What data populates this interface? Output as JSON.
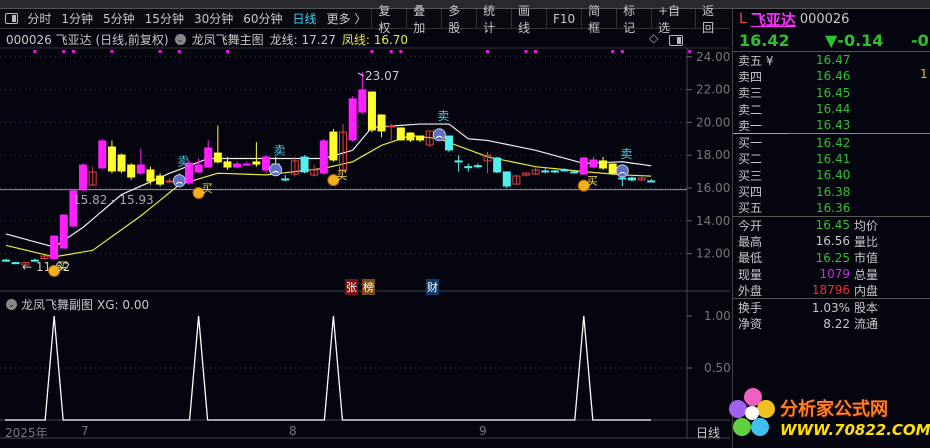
{
  "toolbar": {
    "periods": [
      "分时",
      "1分钟",
      "5分钟",
      "15分钟",
      "30分钟",
      "60分钟",
      "日线",
      "更多 〉"
    ],
    "active": "日线",
    "buttons": [
      "复权",
      "叠加",
      "多股",
      "统计",
      "画线",
      "F10",
      "简框",
      "标记",
      "+自选",
      "返回"
    ]
  },
  "info": {
    "code_name": "000026 飞亚达 (日线,前复权)",
    "indicator": "龙凤飞舞主图",
    "long_label": "龙线: 17.27",
    "phoenix_label": "凤线: 16.70"
  },
  "chart_data": {
    "type": "candlestick",
    "ylim": [
      11,
      24.5
    ],
    "yticks": [
      "24.00",
      "22.00",
      "20.00",
      "18.00",
      "16.00",
      "14.00",
      "12.00"
    ],
    "ytick_values": [
      24,
      22,
      20,
      18,
      16,
      14,
      12
    ],
    "candles": [
      [
        11.6,
        11.6,
        11.7,
        11.5,
        "c"
      ],
      [
        11.45,
        11.4,
        11.5,
        11.35,
        "c"
      ],
      [
        11.3,
        11.45,
        11.5,
        11.3,
        "r"
      ],
      [
        11.6,
        11.6,
        11.7,
        11.5,
        "c"
      ],
      [
        11.7,
        11.85,
        11.9,
        11.65,
        "r"
      ],
      [
        11.7,
        13.07,
        13.1,
        11.6,
        "m"
      ],
      [
        12.34,
        14.35,
        14.4,
        12.3,
        "m"
      ],
      [
        13.68,
        15.82,
        15.9,
        13.6,
        "m"
      ],
      [
        15.88,
        17.4,
        17.5,
        15.8,
        "m"
      ],
      [
        16.18,
        16.98,
        17.3,
        16.1,
        "r"
      ],
      [
        17.22,
        18.87,
        19.0,
        17.2,
        "m"
      ],
      [
        18.5,
        17.04,
        18.9,
        16.9,
        "y"
      ],
      [
        18.01,
        17.04,
        18.1,
        16.9,
        "y"
      ],
      [
        17.4,
        16.67,
        17.5,
        16.5,
        "y"
      ],
      [
        16.91,
        17.4,
        18.4,
        16.8,
        "m"
      ],
      [
        17.1,
        16.43,
        17.3,
        16.2,
        "y"
      ],
      [
        16.73,
        16.24,
        16.9,
        16.1,
        "y"
      ],
      [
        16.43,
        16.43,
        16.6,
        16.3,
        "r"
      ],
      [
        16.61,
        16.61,
        16.9,
        16.5,
        "c"
      ],
      [
        16.3,
        17.52,
        17.7,
        16.2,
        "m"
      ],
      [
        16.98,
        17.4,
        17.8,
        16.9,
        "m"
      ],
      [
        17.28,
        18.44,
        18.9,
        17.2,
        "m"
      ],
      [
        18.13,
        17.59,
        19.8,
        17.5,
        "y"
      ],
      [
        17.59,
        17.28,
        17.9,
        17.1,
        "y"
      ],
      [
        17.28,
        17.46,
        17.6,
        17.2,
        "m"
      ],
      [
        17.46,
        17.46,
        17.6,
        17.35,
        "m"
      ],
      [
        17.59,
        17.46,
        18.8,
        17.3,
        "y"
      ],
      [
        17.89,
        17.1,
        18.0,
        16.9,
        "m"
      ],
      [
        17.46,
        16.85,
        17.9,
        16.8,
        "y"
      ],
      [
        16.55,
        16.55,
        16.8,
        16.4,
        "c"
      ],
      [
        16.85,
        17.65,
        17.9,
        16.7,
        "r"
      ],
      [
        17.89,
        16.98,
        18.0,
        16.9,
        "c"
      ],
      [
        16.79,
        17.1,
        17.4,
        16.7,
        "r"
      ],
      [
        16.91,
        18.87,
        19.0,
        16.8,
        "m"
      ],
      [
        17.71,
        19.41,
        19.6,
        17.6,
        "y"
      ],
      [
        17.1,
        19.41,
        19.9,
        17.0,
        "r"
      ],
      [
        18.93,
        21.43,
        21.6,
        18.8,
        "m"
      ],
      [
        20.63,
        21.98,
        23.07,
        20.5,
        "m"
      ],
      [
        21.85,
        19.54,
        21.9,
        19.4,
        "y"
      ],
      [
        20.45,
        19.48,
        20.5,
        19.1,
        "y"
      ],
      [
        19.78,
        19.78,
        19.9,
        18.9,
        "r"
      ],
      [
        19.66,
        18.93,
        19.7,
        18.9,
        "y"
      ],
      [
        19.35,
        18.93,
        19.4,
        18.8,
        "y"
      ],
      [
        19.17,
        18.93,
        19.2,
        18.8,
        "y"
      ],
      [
        18.62,
        19.48,
        19.5,
        18.5,
        "r"
      ],
      [
        19.23,
        19.23,
        19.3,
        19.1,
        "c"
      ],
      [
        19.17,
        18.32,
        19.2,
        18.2,
        "c"
      ],
      [
        17.65,
        17.65,
        18.0,
        17.0,
        "c"
      ],
      [
        17.3,
        17.3,
        17.5,
        17.0,
        "c"
      ],
      [
        17.36,
        17.36,
        17.5,
        17.2,
        "c"
      ],
      [
        17.65,
        18.0,
        18.2,
        16.9,
        "r"
      ],
      [
        17.83,
        16.98,
        17.9,
        16.9,
        "c"
      ],
      [
        16.98,
        16.12,
        17.0,
        16.0,
        "c"
      ],
      [
        16.24,
        16.73,
        16.8,
        16.2,
        "r"
      ],
      [
        16.79,
        16.91,
        16.95,
        16.7,
        "r"
      ],
      [
        16.85,
        17.1,
        17.3,
        16.8,
        "r"
      ],
      [
        17.04,
        17.04,
        17.2,
        16.9,
        "c"
      ],
      [
        17.04,
        17.04,
        17.1,
        16.9,
        "c"
      ],
      [
        17.1,
        17.1,
        17.2,
        17.0,
        "c"
      ],
      [
        16.98,
        16.98,
        17.1,
        16.9,
        "c"
      ],
      [
        16.85,
        17.83,
        17.9,
        16.8,
        "m"
      ],
      [
        17.28,
        17.71,
        17.9,
        17.2,
        "m"
      ],
      [
        17.65,
        17.22,
        17.9,
        17.1,
        "y"
      ],
      [
        17.46,
        16.91,
        17.5,
        16.8,
        "y"
      ],
      [
        16.61,
        16.61,
        16.7,
        16.1,
        "c"
      ],
      [
        16.61,
        16.49,
        16.7,
        16.4,
        "c"
      ],
      [
        16.49,
        16.61,
        16.7,
        16.4,
        "r"
      ],
      [
        16.43,
        16.43,
        16.55,
        16.35,
        "c"
      ]
    ],
    "long_line": [
      [
        0,
        13.2
      ],
      [
        5,
        12.4
      ],
      [
        8,
        13.6
      ],
      [
        12,
        15.6
      ],
      [
        17,
        16.9
      ],
      [
        21,
        17.8
      ],
      [
        33,
        17.8
      ],
      [
        36,
        18.3
      ],
      [
        38,
        19.7
      ],
      [
        43,
        19.9
      ],
      [
        46,
        19.9
      ],
      [
        48,
        19.0
      ],
      [
        50,
        18.9
      ],
      [
        55,
        18.3
      ],
      [
        60,
        17.5
      ],
      [
        64,
        17.6
      ],
      [
        68,
        17.27
      ]
    ],
    "phoenix_line": [
      [
        0,
        12.5
      ],
      [
        5,
        11.8
      ],
      [
        9,
        12.2
      ],
      [
        14,
        14.3
      ],
      [
        18,
        16.2
      ],
      [
        22,
        16.9
      ],
      [
        27,
        16.8
      ],
      [
        33,
        17.2
      ],
      [
        36,
        17.6
      ],
      [
        39,
        18.6
      ],
      [
        42,
        19.2
      ],
      [
        45,
        19.0
      ],
      [
        50,
        17.9
      ],
      [
        55,
        17.3
      ],
      [
        60,
        17.0
      ],
      [
        64,
        16.8
      ],
      [
        68,
        16.7
      ]
    ],
    "support_line": 15.9,
    "annotations": {
      "range": "15.82 - 15.93",
      "high": "23.07",
      "low": "← 11.62"
    },
    "buy_label": "买",
    "sell_label": "卖",
    "buy_idx": [
      5,
      20,
      34,
      60
    ],
    "sell_idx": [
      18,
      28,
      45,
      64
    ],
    "top_dot_idx": [
      3,
      6,
      7,
      11,
      16,
      18,
      23,
      38,
      40,
      41,
      50,
      54,
      55,
      63,
      64,
      71
    ],
    "events": [
      "张",
      "榜",
      "财"
    ]
  },
  "sub": {
    "title": "龙凤飞舞副图",
    "xg": "XG: 0.00",
    "yticks": [
      "1.00",
      "0.50"
    ],
    "peaks_idx": [
      5,
      20,
      34,
      60
    ]
  },
  "dates": {
    "year": "2025年",
    "months": [
      "7",
      "8",
      "9"
    ],
    "period": "日线"
  },
  "quote": {
    "flag": "L",
    "name": "飞亚达",
    "code": "000026",
    "price": "16.42",
    "change": "▼-0.14",
    "pct": "-0",
    "asks": [
      {
        "label": "卖五 ¥",
        "price": "16.47"
      },
      {
        "label": "卖四",
        "price": "16.46"
      },
      {
        "label": "卖三",
        "price": "16.45"
      },
      {
        "label": "卖二",
        "price": "16.44"
      },
      {
        "label": "卖一",
        "price": "16.43"
      }
    ],
    "ask5_extra": "1",
    "bids": [
      {
        "label": "买一",
        "price": "16.42"
      },
      {
        "label": "买二",
        "price": "16.41"
      },
      {
        "label": "买三",
        "price": "16.40"
      },
      {
        "label": "买四",
        "price": "16.38"
      },
      {
        "label": "买五",
        "price": "16.36"
      }
    ],
    "stats": [
      {
        "l": "今开",
        "v": "16.45",
        "r": "均价",
        "c": "#2ec02e"
      },
      {
        "l": "最高",
        "v": "16.56",
        "r": "量比",
        "c": "#c8c8c8"
      },
      {
        "l": "最低",
        "v": "16.25",
        "r": "市值",
        "c": "#2ec02e"
      },
      {
        "l": "现量",
        "v": "1079",
        "r": "总量",
        "c": "#c030e0"
      },
      {
        "l": "外盘",
        "v": "18796",
        "r": "内盘",
        "c": "#e83030"
      }
    ],
    "stats2": [
      {
        "l": "换手",
        "v": "1.03%",
        "r": "股本"
      },
      {
        "l": "净资",
        "v": "8.22",
        "r": "流通"
      }
    ]
  },
  "watermark": {
    "title": "分析家公式网",
    "url": "WWW.70822.COM"
  }
}
